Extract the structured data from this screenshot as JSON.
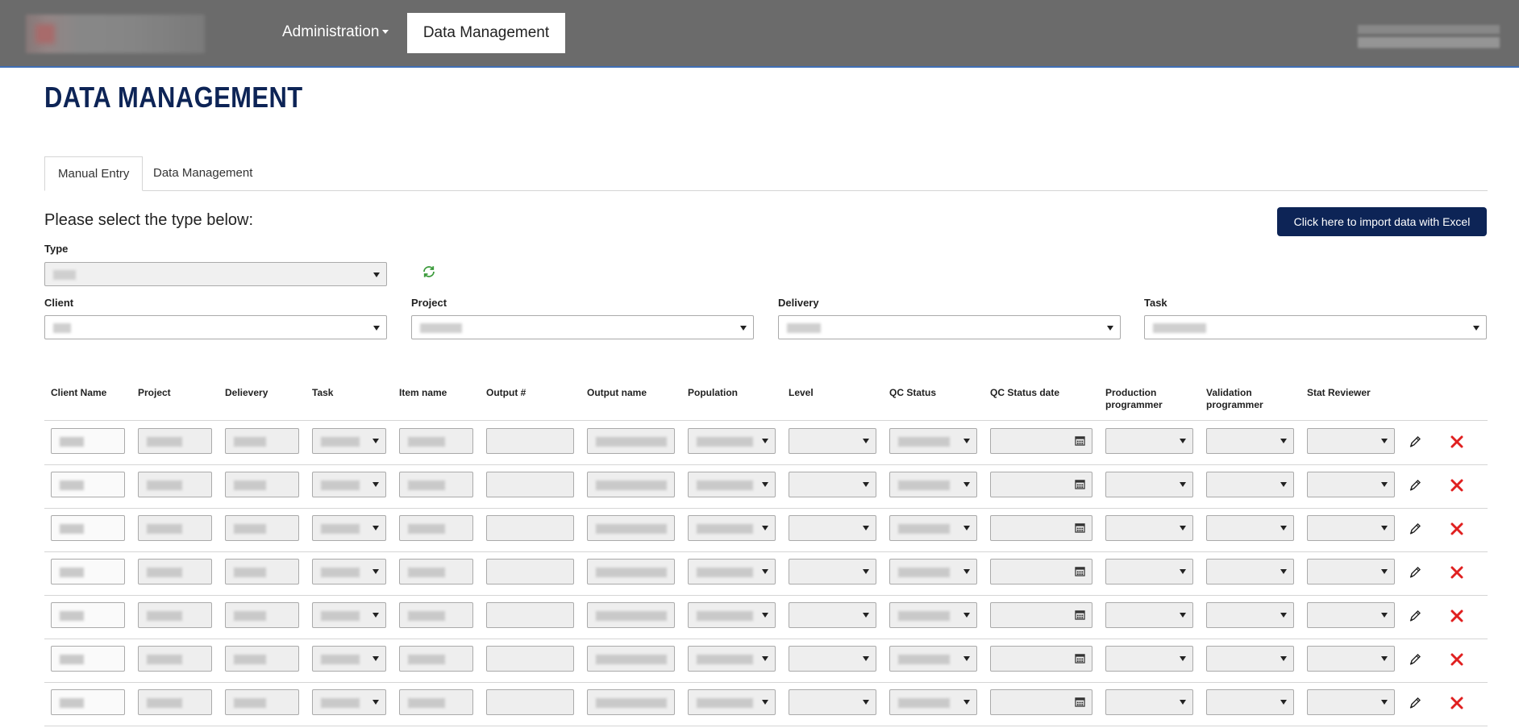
{
  "nav": {
    "admin_label": "Administration",
    "dm_label": "Data Management"
  },
  "page": {
    "title": "DATA MANAGEMENT"
  },
  "tabs": [
    {
      "label": "Manual Entry",
      "active": true
    },
    {
      "label": "Data Management",
      "active": false
    }
  ],
  "prompt": "Please select the type below:",
  "import_button": "Click here to import data with Excel",
  "filters": {
    "type_label": "Type",
    "client_label": "Client",
    "project_label": "Project",
    "delivery_label": "Delivery",
    "task_label": "Task"
  },
  "table": {
    "columns": [
      "Client Name",
      "Project",
      "Delievery",
      "Task",
      "Item name",
      "Output #",
      "Output name",
      "Population",
      "Level",
      "QC Status",
      "QC Status date",
      "Production programmer",
      "Validation programmer",
      "Stat Reviewer"
    ],
    "row_count": 7
  },
  "icons": {
    "refresh": "refresh-icon",
    "edit": "pencil-icon",
    "delete": "close-icon",
    "calendar": "calendar-icon"
  },
  "colors": {
    "brand": "#0d2456",
    "navbar": "#6b6b6b",
    "refresh": "#3a9a3a",
    "delete": "#e02020"
  }
}
